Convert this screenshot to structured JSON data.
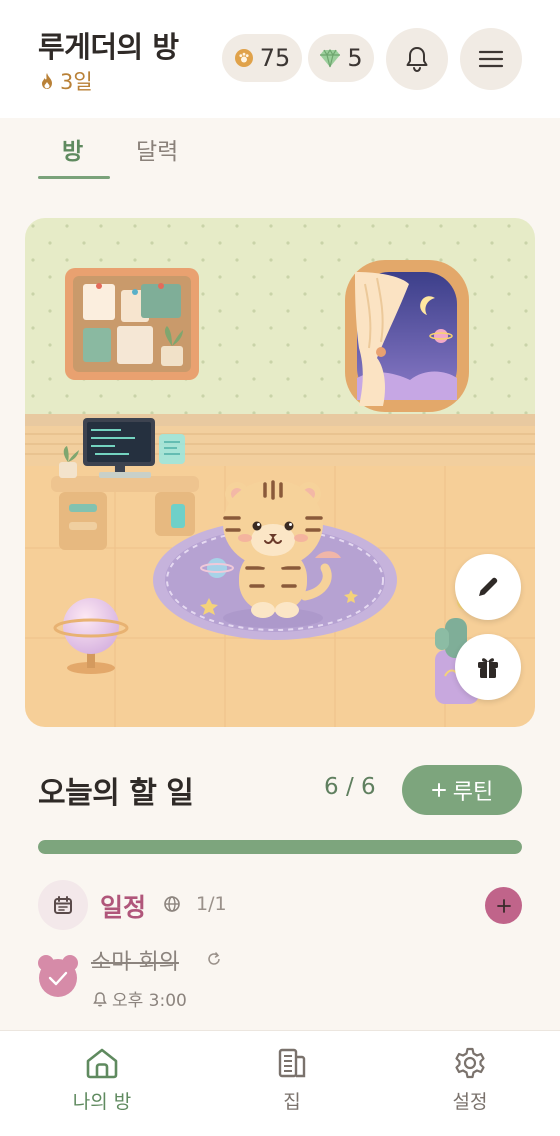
{
  "header": {
    "title": "루게더의 방",
    "streak_days": "3일",
    "coins": "75",
    "gems": "5"
  },
  "tabs": [
    {
      "label": "방",
      "active": true
    },
    {
      "label": "달력",
      "active": false
    }
  ],
  "todo": {
    "title": "오늘의 할 일",
    "count": "6 / 6",
    "routine_button": "루틴",
    "progress": 1.0
  },
  "category": {
    "label": "일정",
    "count": "1/1"
  },
  "task": {
    "title": "소마 회의",
    "time": "오후 3:00",
    "completed": true
  },
  "nav": [
    {
      "label": "나의 방",
      "icon": "home-icon",
      "active": true
    },
    {
      "label": "집",
      "icon": "building-icon",
      "active": false
    },
    {
      "label": "설정",
      "icon": "gear-icon",
      "active": false
    }
  ],
  "colors": {
    "accent_green": "#7da57d",
    "category_pink": "#c0648a",
    "streak_orange": "#b98137",
    "background": "#faf6f1"
  }
}
